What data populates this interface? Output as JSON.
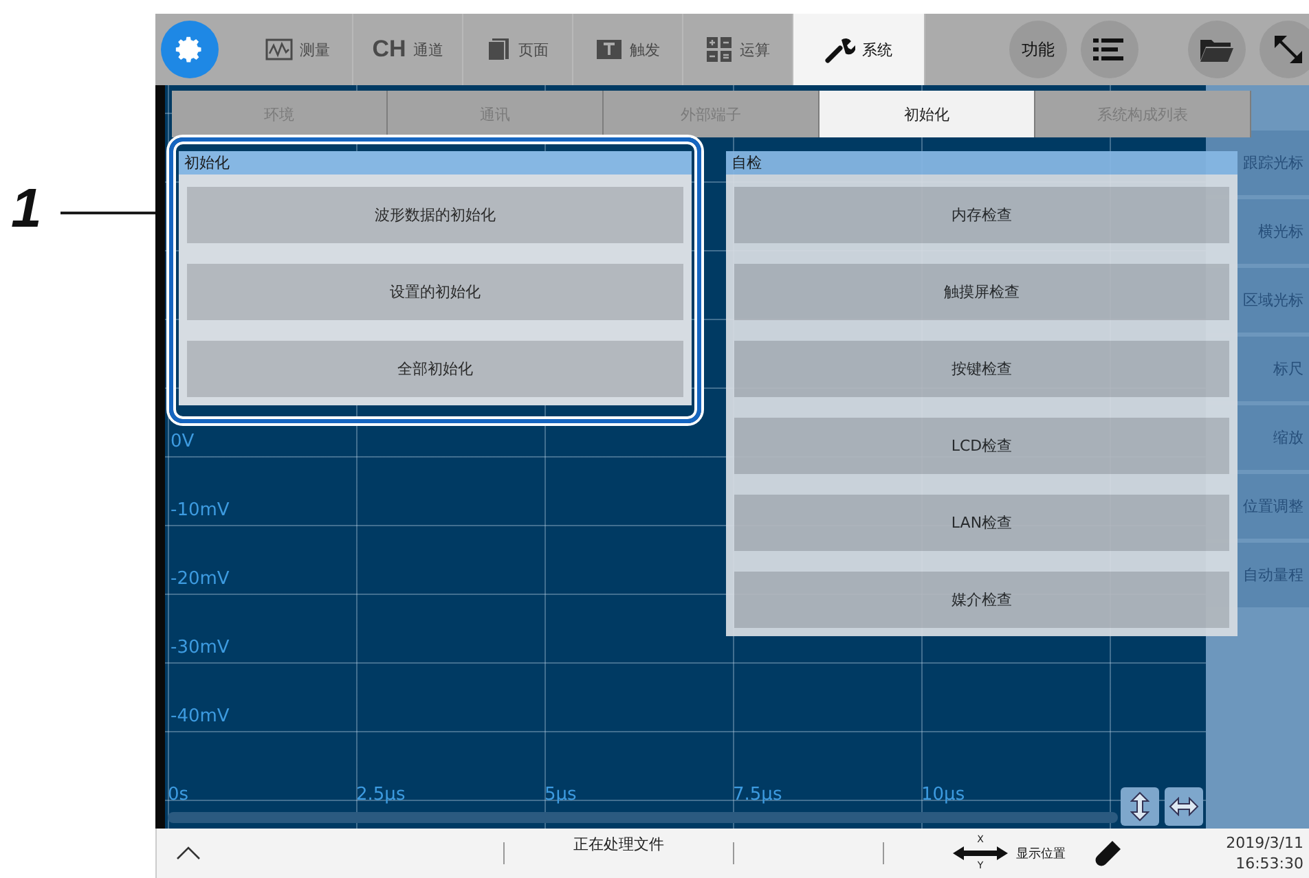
{
  "callout": {
    "label": "1"
  },
  "toolbar": {
    "items": [
      {
        "kind": "measure",
        "label": "测量",
        "selected": false
      },
      {
        "kind": "channel",
        "badge": "CH",
        "label": "通道",
        "selected": false
      },
      {
        "kind": "page",
        "label": "页面",
        "selected": false
      },
      {
        "kind": "trigger",
        "label": "触发",
        "selected": false
      },
      {
        "kind": "math",
        "label": "运算",
        "selected": false
      },
      {
        "kind": "system",
        "label": "系统",
        "selected": true
      }
    ],
    "function_button": "功能"
  },
  "tabs": [
    {
      "label": "环境",
      "selected": false
    },
    {
      "label": "通讯",
      "selected": false
    },
    {
      "label": "外部端子",
      "selected": false
    },
    {
      "label": "初始化",
      "selected": true
    },
    {
      "label": "系统构成列表",
      "selected": false
    }
  ],
  "plot": {
    "y_labels": [
      "0V",
      "-10mV",
      "-20mV",
      "-30mV",
      "-40mV"
    ],
    "x_labels": [
      "0s",
      "2.5μs",
      "5μs",
      "7.5μs",
      "10μs"
    ]
  },
  "side_panel": [
    "跟踪光标",
    "横光标",
    "区域光标",
    "标尺",
    "缩放",
    "位置调整",
    "自动量程"
  ],
  "init_dialog": {
    "title": "初始化",
    "buttons": [
      "波形数据的初始化",
      "设置的初始化",
      "全部初始化"
    ]
  },
  "selftest_dialog": {
    "title": "自检",
    "buttons": [
      "内存检查",
      "触摸屏检查",
      "按键检查",
      "LCD检查",
      "LAN检查",
      "媒介检查"
    ]
  },
  "status_bar": {
    "message": "正在处理文件",
    "x_label": "X",
    "y_label": "Y",
    "position_label": "显示位置",
    "date": "2019/3/11",
    "time": "16:53:30"
  }
}
